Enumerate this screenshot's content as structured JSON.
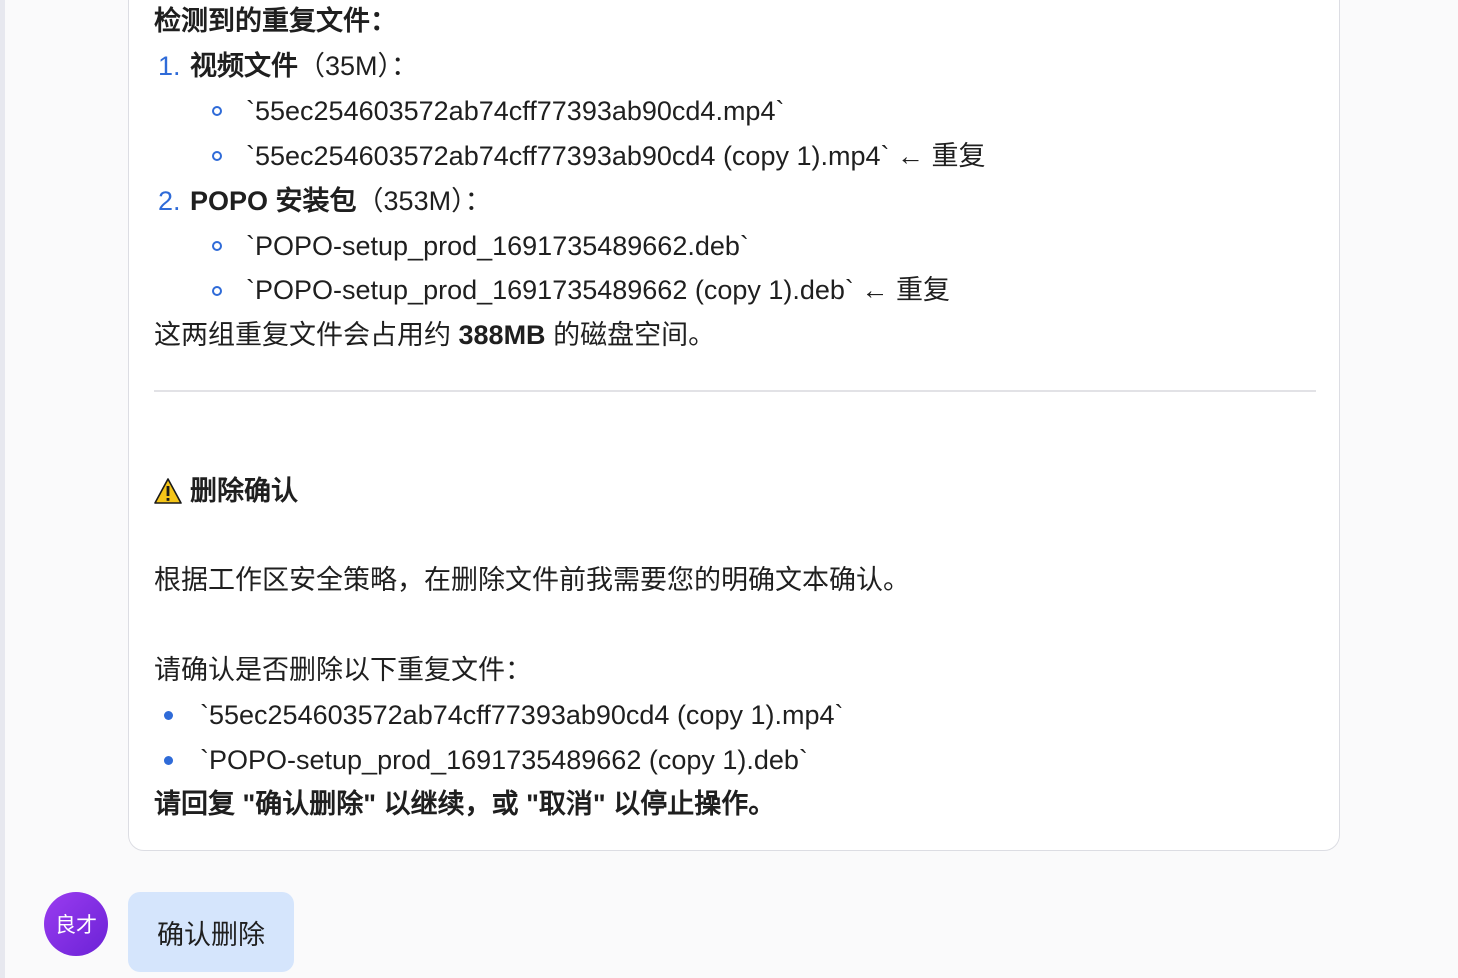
{
  "message": {
    "heading_detected": "检测到的重复文件：",
    "groups": [
      {
        "index": "1.",
        "title": "视频文件",
        "size": "（35M）：",
        "files": [
          {
            "name": "`55ec254603572ab74cff77393ab90cd4.mp4`",
            "tag": ""
          },
          {
            "name": "`55ec254603572ab74cff77393ab90cd4 (copy 1).mp4`",
            "tag": "← 重复"
          }
        ]
      },
      {
        "index": "2.",
        "title": "POPO 安装包",
        "size": "（353M）：",
        "files": [
          {
            "name": "`POPO-setup_prod_1691735489662.deb`",
            "tag": ""
          },
          {
            "name": "`POPO-setup_prod_1691735489662 (copy 1).deb`",
            "tag": "← 重复"
          }
        ]
      }
    ],
    "summary_prefix": "这两组重复文件会占用约 ",
    "summary_size": "388MB",
    "summary_suffix": " 的磁盘空间。",
    "delete_confirm_title": "删除确认",
    "policy_text": "根据工作区安全策略，在删除文件前我需要您的明确文本确认。",
    "confirm_prompt": "请确认是否删除以下重复文件：",
    "delete_list": [
      "`55ec254603572ab74cff77393ab90cd4 (copy 1).mp4`",
      "`POPO-setup_prod_1691735489662 (copy 1).deb`"
    ],
    "reply_instruction": "请回复 \"确认删除\" 以继续，或 \"取消\" 以停止操作。"
  },
  "user": {
    "avatar_text": "良才",
    "reply": "确认删除"
  },
  "icons": {
    "warning": "warning-icon"
  },
  "colors": {
    "accent_blue": "#2f6bd8",
    "user_bubble": "#d5e5fc",
    "avatar": "#7b2ee0",
    "warning": "#f5c518"
  }
}
